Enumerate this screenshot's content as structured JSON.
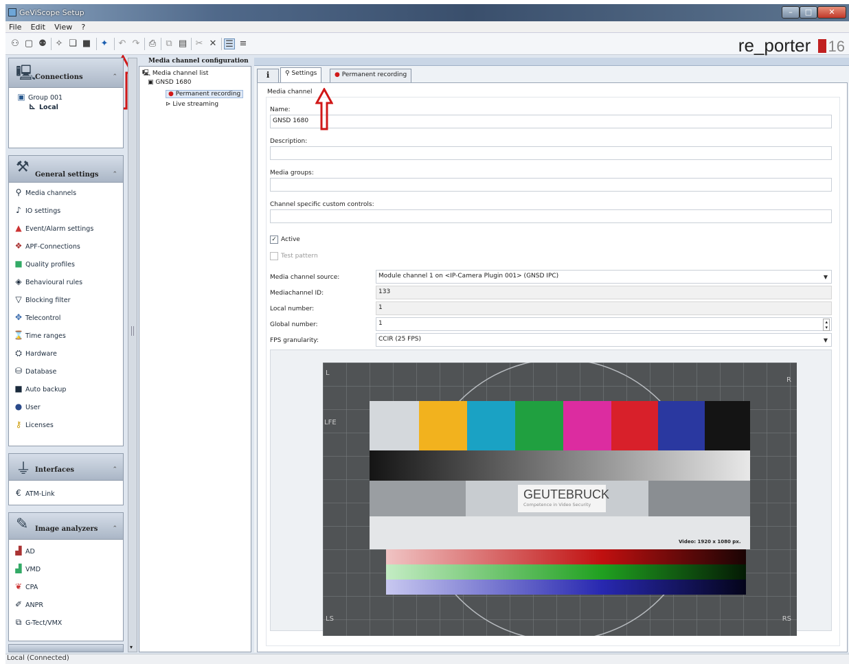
{
  "window": {
    "title": "GeViScope Setup"
  },
  "menu": [
    "File",
    "Edit",
    "View",
    "?"
  ],
  "brand": {
    "name": "re_porter",
    "version": "16"
  },
  "sidebar": {
    "connections": {
      "title": "Connections",
      "tree": [
        "Group 001",
        "Local"
      ]
    },
    "general": {
      "title": "General settings",
      "items": [
        {
          "label": "Media channels",
          "icon": "camera-icon"
        },
        {
          "label": "IO settings",
          "icon": "io-icon"
        },
        {
          "label": "Event/Alarm settings",
          "icon": "alarm-icon"
        },
        {
          "label": "APF-Connections",
          "icon": "connections-icon"
        },
        {
          "label": "Quality profiles",
          "icon": "quality-icon"
        },
        {
          "label": "Behavioural rules",
          "icon": "rules-icon"
        },
        {
          "label": "Blocking filter",
          "icon": "filter-icon"
        },
        {
          "label": "Telecontrol",
          "icon": "telecontrol-icon"
        },
        {
          "label": "Time ranges",
          "icon": "time-icon"
        },
        {
          "label": "Hardware",
          "icon": "hardware-icon"
        },
        {
          "label": "Database",
          "icon": "database-icon"
        },
        {
          "label": "Auto backup",
          "icon": "backup-icon"
        },
        {
          "label": "User",
          "icon": "user-icon"
        },
        {
          "label": "Licenses",
          "icon": "license-icon"
        }
      ]
    },
    "interfaces": {
      "title": "Interfaces",
      "items": [
        {
          "label": "ATM-Link",
          "icon": "atm-icon"
        }
      ]
    },
    "analyzers": {
      "title": "Image analyzers",
      "items": [
        {
          "label": "AD",
          "icon": "ad-icon"
        },
        {
          "label": "VMD",
          "icon": "vmd-icon"
        },
        {
          "label": "CPA",
          "icon": "cpa-icon"
        },
        {
          "label": "ANPR",
          "icon": "anpr-icon"
        },
        {
          "label": "G-Tect/VMX",
          "icon": "gtect-icon"
        }
      ]
    }
  },
  "tree": {
    "header": "Media channel configuration",
    "root": "Media channel list",
    "device": "GNSD 1680",
    "children": [
      "Permanent recording",
      "Live streaming"
    ]
  },
  "tabs": [
    "Settings",
    "Permanent recording"
  ],
  "form": {
    "section": "Media channel",
    "name_label": "Name:",
    "name_value": "GNSD 1680",
    "description_label": "Description:",
    "description_value": "",
    "media_groups_label": "Media groups:",
    "media_groups_value": "",
    "custom_controls_label": "Channel specific custom controls:",
    "custom_controls_value": "",
    "active_label": "Active",
    "test_pattern_label": "Test pattern",
    "source_label": "Media channel source:",
    "source_value": "Module channel 1 on <IP-Camera Plugin 001> (GNSD IPC)",
    "id_label": "Mediachannel ID:",
    "id_value": "133",
    "local_label": "Local number:",
    "local_value": "1",
    "global_label": "Global number:",
    "global_value": "1",
    "fps_label": "FPS granularity:",
    "fps_value": "CCIR (25 FPS)"
  },
  "testimage": {
    "brand": "GEUTEBRUCK",
    "tagline": "Competence in Video Security",
    "resolution": "Video: 1920 x 1080 px.",
    "corners": [
      "L",
      "R",
      "LFE",
      "LS",
      "RS"
    ]
  },
  "status": "Local (Connected)",
  "colors": {
    "accent_red": "#d01818",
    "header_blue": "#c9d6e6"
  }
}
